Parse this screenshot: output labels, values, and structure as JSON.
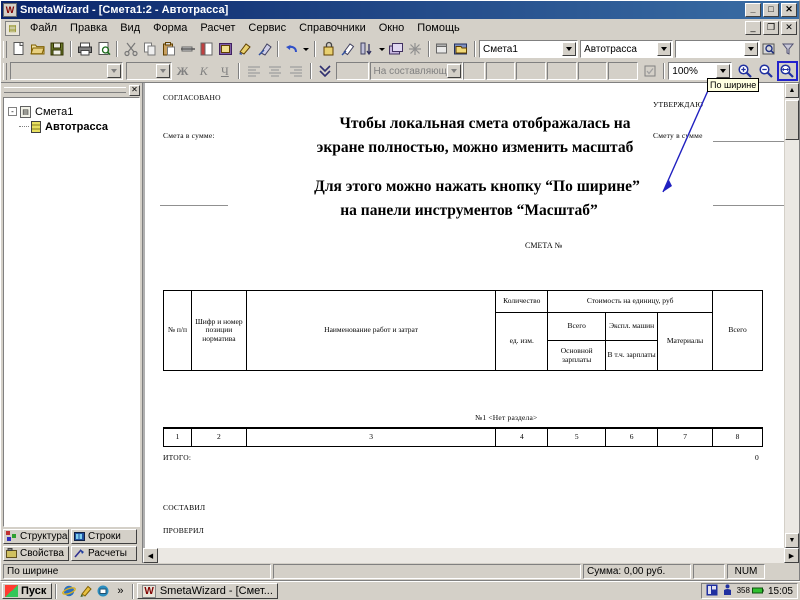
{
  "window": {
    "title": "SmetaWizard - [Смета1:2 - Автотрасса]",
    "app_icon": "W",
    "minimize": "_",
    "maximize": "□",
    "close": "✕",
    "mdi_minimize": "_",
    "mdi_restore": "❐",
    "mdi_close": "✕"
  },
  "menu": {
    "items": [
      {
        "label": "Файл"
      },
      {
        "label": "Правка"
      },
      {
        "label": "Вид"
      },
      {
        "label": "Форма"
      },
      {
        "label": "Расчет"
      },
      {
        "label": "Сервис"
      },
      {
        "label": "Справочники"
      },
      {
        "label": "Окно"
      },
      {
        "label": "Помощь"
      }
    ]
  },
  "toolbar1": {
    "buttons": [
      {
        "name": "new-document-icon",
        "glyph": "📄"
      },
      {
        "name": "open-folder-icon",
        "glyph": "📂"
      },
      {
        "name": "save-icon",
        "glyph": "💾"
      },
      {
        "name": "print-icon",
        "glyph": "🖨"
      },
      {
        "name": "print-preview-icon",
        "glyph": "🔍"
      },
      {
        "name": "cut-icon",
        "glyph": "✂"
      },
      {
        "name": "copy-icon",
        "glyph": "⧉"
      },
      {
        "name": "paste-icon",
        "glyph": "📋"
      },
      {
        "name": "delete-row-icon",
        "glyph": "➖"
      },
      {
        "name": "insert-row-icon",
        "glyph": "▤"
      },
      {
        "name": "export-icon",
        "glyph": "▣"
      },
      {
        "name": "format-painter-icon",
        "glyph": "🖌"
      },
      {
        "name": "clear-format-icon",
        "glyph": "🗑"
      },
      {
        "name": "undo-icon",
        "glyph": "↩"
      },
      {
        "name": "undo-dropdown-icon",
        "glyph": "▾"
      },
      {
        "name": "lock-icon",
        "glyph": "🔒"
      },
      {
        "name": "highlight-icon",
        "glyph": "🖍"
      },
      {
        "name": "sort-icon",
        "glyph": "⇅"
      },
      {
        "name": "sort-dropdown-icon",
        "glyph": "▾"
      },
      {
        "name": "group-icon",
        "glyph": "▤"
      },
      {
        "name": "recalc-icon",
        "glyph": "✳"
      },
      {
        "name": "properties-icon",
        "glyph": "🗔"
      },
      {
        "name": "folder-open-icon",
        "glyph": "🗂"
      }
    ],
    "smeta_combo": {
      "value": "Смета1"
    },
    "object_combo": {
      "value": "Автотрасса"
    },
    "section_combo": {
      "value": ""
    },
    "find_icon": "🔎",
    "filter_icon": "⫝"
  },
  "toolbar2": {
    "font_combo": {
      "value": ""
    },
    "size_combo": {
      "value": ""
    },
    "bold_label": "Ж",
    "italic_label": "К",
    "underline_label": "Ч",
    "align_left_icon": "≡",
    "align_center_icon": "≡",
    "align_right_icon": "≡",
    "expand_icon": "⋙",
    "small_box": "",
    "decompose_combo": {
      "value": "На составляющие"
    },
    "checkbox_icon": "☑",
    "zoom_combo": {
      "value": "100%"
    },
    "zoom_in_icon": "zoom-in",
    "zoom_out_icon": "zoom-out",
    "zoom_fit_icon": "zoom-fit-width"
  },
  "tooltip": {
    "text": "По ширине"
  },
  "sidebar": {
    "close_label": "✕",
    "tree": [
      {
        "label": "Смета1",
        "bold": false,
        "level": 0,
        "toggle": "-"
      },
      {
        "label": "Автотрасса",
        "bold": true,
        "level": 1,
        "toggle": ""
      }
    ],
    "tabs": [
      {
        "label": "Структура",
        "name": "sidebar-tab-structure"
      },
      {
        "label": "Строки",
        "name": "sidebar-tab-rows"
      },
      {
        "label": "Свойства",
        "name": "sidebar-tab-properties"
      },
      {
        "label": "Расчеты",
        "name": "sidebar-tab-calculations"
      }
    ]
  },
  "document": {
    "soglasovano": "СОГЛАСОВАНО",
    "utverzhdayu": "УТВЕРЖДАЮ",
    "smeta_v_summe": "Смета в сумме:",
    "smetu_v_summe": "Смету в сумме",
    "smeta_no": "СМЕТА №",
    "headline": [
      "Чтобы локальная смета отображалась на",
      "экране полностью, можно изменить масштаб"
    ],
    "headline2": [
      "Для этого можно нажать кнопку “По ширине”",
      "на панели инструментов “Масштаб”"
    ],
    "section_row": "№1 <Нет раздела>",
    "itogo_label": "ИТОГО:",
    "itogo_value": "0",
    "sostavil": "СОСТАВИЛ",
    "proveril": "ПРОВЕРИЛ",
    "table": {
      "headers": {
        "num": "№ п/п",
        "code": "Шифр и номер позиции норматива",
        "name": "Наименование работ и затрат",
        "qty": "Количество",
        "qty_unit": "ед. изм.",
        "cost_group": "Стоимость на единицу, руб",
        "total1": "Всего",
        "oper": "Экспл. машин",
        "osnovnoy": "Основной зарплаты",
        "vtch": "В т.ч. зарплаты",
        "materials": "Материалы",
        "total2": "Всего"
      },
      "number_row": [
        "1",
        "2",
        "3",
        "4",
        "5",
        "6",
        "7",
        "8"
      ]
    }
  },
  "statusbar": {
    "hint": "По ширине",
    "sum": "Сумма: 0,00 руб.",
    "blank": "",
    "num": "NUM"
  },
  "taskbar": {
    "start_label": "Пуск",
    "quick_launch": [
      {
        "name": "internet-explorer-icon",
        "glyph": "e"
      },
      {
        "name": "edit-icon",
        "glyph": "✎"
      },
      {
        "name": "outlook-icon",
        "glyph": "✉"
      },
      {
        "name": "more-icon",
        "glyph": "»"
      }
    ],
    "task": {
      "icon": "W",
      "label": "SmetaWizard - [Смет..."
    },
    "tray": [
      {
        "name": "tray-layout-icon",
        "glyph": "▨"
      },
      {
        "name": "tray-keyboard-icon",
        "glyph": "⌨"
      },
      {
        "name": "tray-battery-label",
        "glyph": "358"
      }
    ],
    "clock": "15:05"
  }
}
